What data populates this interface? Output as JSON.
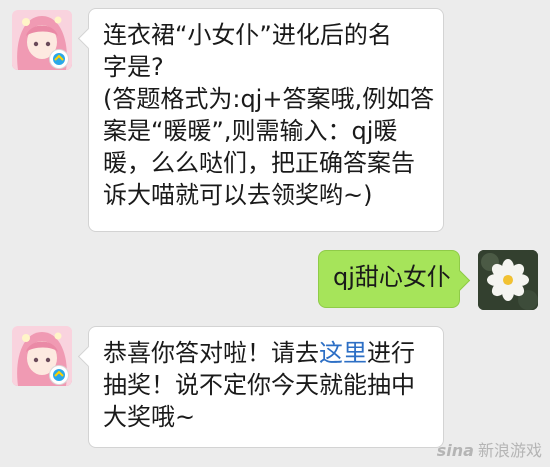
{
  "messages": {
    "m1": {
      "lines": [
        "连衣裙“小女仆”进化后的名",
        "字是?",
        "(答题格式为:qj+答案哦,例如答",
        "案是“暖暖”,则需输入：qj暖",
        "暖，么么哒们，把正确答案告",
        "诉大喵就可以去领奖哟~)"
      ]
    },
    "m2": {
      "text": "qj甜心女仆"
    },
    "m3": {
      "line1_pre": "恭喜你答对啦！请去",
      "line1_link": "这里",
      "line1_post": "进行",
      "line2": "抽奖！说不定你今天就能抽中",
      "line3": "大奖哦~"
    }
  },
  "watermark": {
    "logo": "sina",
    "text": "新浪游戏"
  },
  "colors": {
    "background": "#ececec",
    "sent_bubble": "#a6e45a",
    "link": "#2d6fc5"
  }
}
